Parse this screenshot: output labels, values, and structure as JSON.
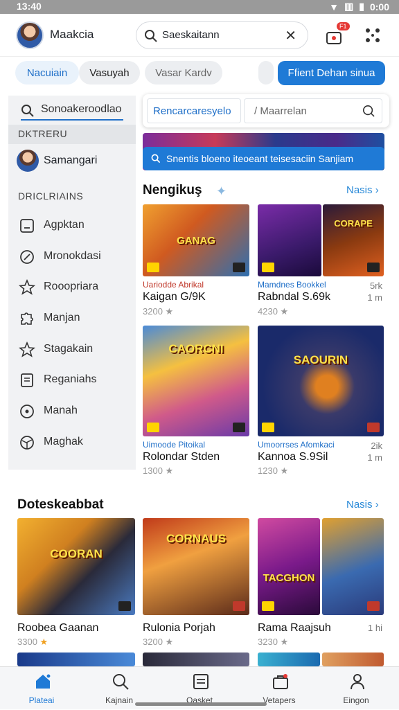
{
  "status": {
    "time": "13:40",
    "battery": "0:00"
  },
  "header": {
    "app_name": "Maakcia",
    "search_value": "Saeskaitann",
    "notif_badge": "F1"
  },
  "chips": [
    "Nacuiain",
    "Vasuyah",
    "Vasar Kardv"
  ],
  "primary_button": "Ffient Dehan sinua",
  "sidebar": {
    "search_value": "Sonoakeroodlao",
    "section1": "DKTRERU",
    "user_name": "Samangari",
    "section2": "DRICLRIAINS",
    "items": [
      {
        "label": "Agpktan",
        "icon": "square-icon"
      },
      {
        "label": "Mronokdasi",
        "icon": "compass-icon"
      },
      {
        "label": "Rooopriara",
        "icon": "star-icon"
      },
      {
        "label": "Manjan",
        "icon": "puzzle-icon"
      },
      {
        "label": "Stagakain",
        "icon": "star-outline-icon"
      },
      {
        "label": "Reganiahs",
        "icon": "book-icon"
      },
      {
        "label": "Manah",
        "icon": "disc-icon"
      },
      {
        "label": "Maghak",
        "icon": "ball-icon"
      }
    ]
  },
  "dropdown": {
    "left": "Rencarcaresyelo",
    "right": "Maarrelan"
  },
  "banner": {
    "text": "Snentis bloeno iteoeant teisesaciin Sanjiam"
  },
  "section1": {
    "title": "Nengikuş",
    "more": "Nasis",
    "cards": [
      {
        "label": "GANAG",
        "sub": "Uariodde Abrikal",
        "title": "Kaigan G/9K",
        "rating": "3200",
        "side": "",
        "colors": [
          "#f0a030",
          "#2e6fb0"
        ]
      },
      {
        "label": "CORAPE",
        "sub": "Mamdnes Bookkel",
        "title": "Rabndal S.69k",
        "rating": "4230",
        "side": "5rk\n1 m",
        "colors": [
          "#6a2c9a",
          "#2a1a5a"
        ]
      }
    ]
  },
  "section1_row2": [
    {
      "label": "CAORCNI",
      "sub": "Uimoode Pitoikal",
      "title": "Rolondar Stden",
      "rating": "1300",
      "side": "",
      "colors": [
        "#f5c040",
        "#6a3aa8"
      ]
    },
    {
      "label": "SAOURIN",
      "sub": "Umoorrses Afomkaci",
      "title": "Kannoa S.9Sil",
      "rating": "1230",
      "side": "2ik\n1 m",
      "colors": [
        "#1a2a6a",
        "#e08020"
      ]
    }
  ],
  "section2": {
    "title": "Doteskeabbat",
    "more": "Nasis",
    "cards": [
      {
        "label": "COORAN",
        "title": "Roobea Gaanan",
        "rating": "3300",
        "side": "",
        "colors": [
          "#f2b030",
          "#2a2a3a"
        ]
      },
      {
        "label": "CORNAUS",
        "title": "Rulonia Porjah",
        "rating": "3200",
        "side": "",
        "colors": [
          "#c03a1a",
          "#f0a040"
        ]
      },
      {
        "label": "TACGHON",
        "title": "Rama Raajsuh",
        "rating": "3230",
        "side": "1 hi",
        "colors": [
          "#7a1a8a",
          "#3a6ab0"
        ]
      }
    ]
  },
  "bottom_nav": [
    {
      "label": "Plateai",
      "icon": "home-icon",
      "active": true
    },
    {
      "label": "Kajnain",
      "icon": "search-icon",
      "active": false
    },
    {
      "label": "Oasket",
      "icon": "document-icon",
      "active": false
    },
    {
      "label": "Vetapers",
      "icon": "briefcase-icon",
      "active": false
    },
    {
      "label": "Eingon",
      "icon": "person-icon",
      "active": false
    }
  ],
  "colors": {
    "accent": "#1f7ad6",
    "link": "#2a8ad8",
    "sidebar_bg": "#f1f2f4"
  }
}
